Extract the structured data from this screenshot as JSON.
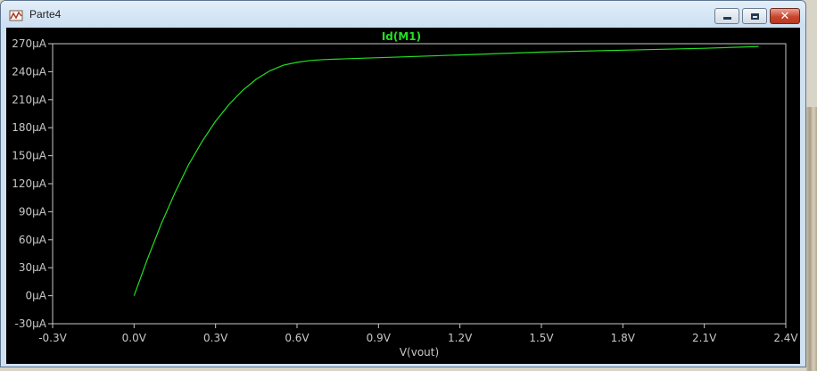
{
  "window": {
    "title": "Parte4",
    "icons": {
      "app": "waveform-viewer-icon",
      "minimize": "minimize-icon",
      "maximize": "maximize-icon",
      "close": "close-icon"
    }
  },
  "colors": {
    "plot_background": "#000000",
    "trace": "#22e022",
    "axis": "#c8c8c8"
  },
  "chart_data": {
    "type": "line",
    "title": "Id(M1)",
    "xlabel": "V(vout)",
    "ylabel": "",
    "xlim": [
      -0.3,
      2.4
    ],
    "ylim": [
      -30,
      270
    ],
    "x_ticks": [
      -0.3,
      0.0,
      0.3,
      0.6,
      0.9,
      1.2,
      1.5,
      1.8,
      2.1,
      2.4
    ],
    "x_tick_labels": [
      "-0.3V",
      "0.0V",
      "0.3V",
      "0.6V",
      "0.9V",
      "1.2V",
      "1.5V",
      "1.8V",
      "2.1V",
      "2.4V"
    ],
    "y_ticks": [
      -30,
      0,
      30,
      60,
      90,
      120,
      150,
      180,
      210,
      240,
      270
    ],
    "y_tick_labels": [
      "-30µA",
      "0µA",
      "30µA",
      "60µA",
      "90µA",
      "120µA",
      "150µA",
      "180µA",
      "210µA",
      "240µA",
      "270µA"
    ],
    "grid": false,
    "series": [
      {
        "name": "Id(M1)",
        "x": [
          0.0,
          0.02,
          0.05,
          0.1,
          0.15,
          0.2,
          0.25,
          0.3,
          0.35,
          0.4,
          0.45,
          0.5,
          0.55,
          0.6,
          0.65,
          0.7,
          0.8,
          0.9,
          1.0,
          1.2,
          1.5,
          1.8,
          2.1,
          2.3
        ],
        "values": [
          0,
          16,
          40,
          77,
          110,
          140,
          165,
          187,
          205,
          220,
          232,
          241,
          247,
          250,
          252,
          253,
          254,
          255,
          256,
          258,
          261,
          263,
          265,
          267
        ]
      }
    ]
  }
}
